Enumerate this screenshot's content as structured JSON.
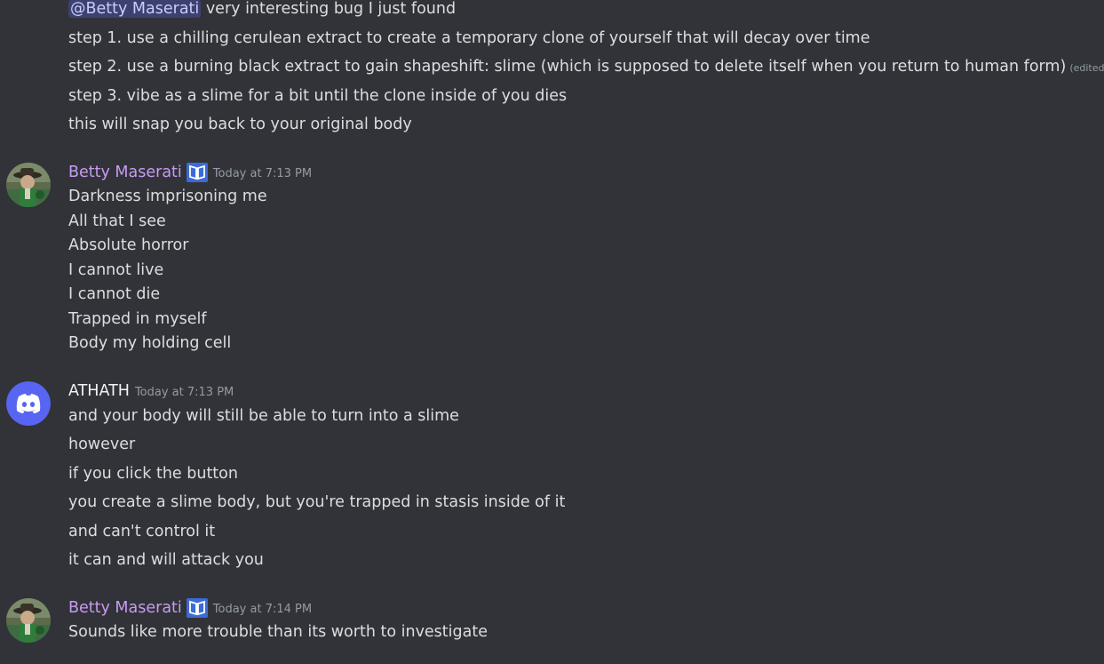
{
  "colors": {
    "background": "#313338",
    "text": "#dbdee1",
    "betty_name": "#c89bf2",
    "athath_name": "#f2f3f5",
    "mention_bg": "#3c4270",
    "timestamp": "#949ba4",
    "discord_blurple": "#5865f2"
  },
  "group0": {
    "mention": "@Betty Maserati",
    "line1_rest": " very interesting bug I just found",
    "line2": "step 1. use a chilling cerulean extract to create a temporary clone of yourself that will decay over time",
    "line3": "step 2. use a burning black extract to gain shapeshift: slime (which is supposed to delete itself when you return to human form)",
    "line3_edited": "(edited)",
    "line4": "step 3. vibe as a slime for a bit until the clone inside of you dies",
    "line5": "this will snap you back to your original body"
  },
  "msg1": {
    "author": "Betty Maserati",
    "badge_icon": "book-icon",
    "timestamp": "Today at 7:13 PM",
    "lines": [
      "Darkness imprisoning me",
      "All that I see",
      "Absolute horror",
      "I cannot live",
      "I cannot die",
      "Trapped in myself",
      "Body my holding cell"
    ]
  },
  "msg2": {
    "author": "ATHATH",
    "avatar_icon": "discord-logo-icon",
    "timestamp": "Today at 7:13 PM",
    "lines": [
      "and your body will still be able to turn into a slime",
      "however",
      "if you click the button",
      "you create a slime body, but you're trapped in stasis inside of it",
      "and can't control it",
      "it can and will attack you"
    ]
  },
  "msg3": {
    "author": "Betty Maserati",
    "badge_icon": "book-icon",
    "timestamp": "Today at 7:14 PM",
    "lines": [
      "Sounds like more trouble than its worth to investigate"
    ]
  }
}
